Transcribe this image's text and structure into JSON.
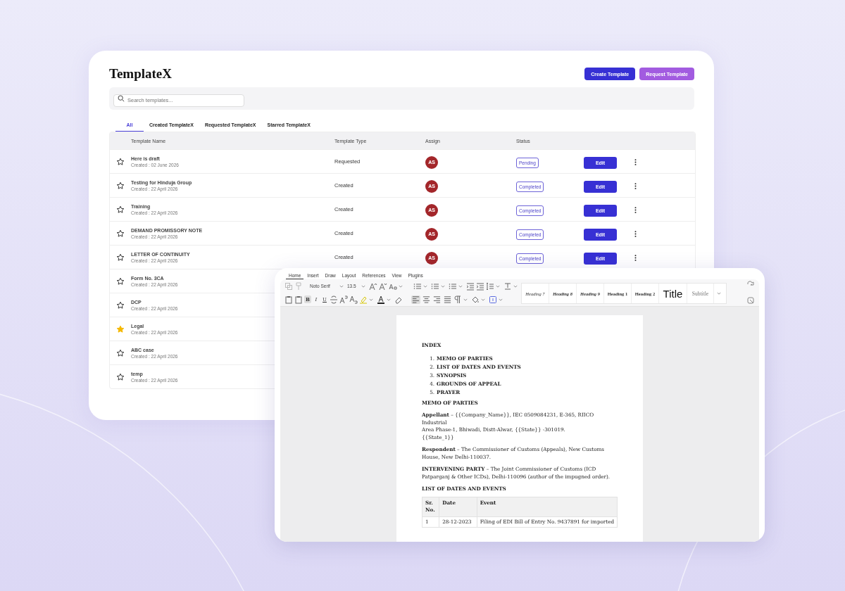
{
  "app": {
    "title": "TemplateX",
    "buttons": [
      {
        "label": "Create Template",
        "kind": "primary"
      },
      {
        "label": "Request Template",
        "kind": "secondary"
      }
    ],
    "search": {
      "placeholder": "Search templates..."
    },
    "tabs": [
      {
        "label": "All",
        "selected": true
      },
      {
        "label": "Created TemplateX",
        "selected": false
      },
      {
        "label": "Requested TemplateX",
        "selected": false
      },
      {
        "label": "Starred TemplateX",
        "selected": false
      }
    ],
    "table": {
      "columns": [
        "Template Name",
        "Template Type",
        "Assign",
        "Status"
      ],
      "rows": [
        {
          "starred": false,
          "name": "Here is draft",
          "created": "Created : 02 June 2026",
          "type": "Requested",
          "assignee": "AS",
          "status": "Pending",
          "action": "Edit"
        },
        {
          "starred": false,
          "name": "Testing for Hinduja Group",
          "created": "Created : 22 April 2026",
          "type": "Created",
          "assignee": "AS",
          "status": "Completed",
          "action": "Edit"
        },
        {
          "starred": false,
          "name": "Training",
          "created": "Created : 22 April 2026",
          "type": "Created",
          "assignee": "AS",
          "status": "Completed",
          "action": "Edit"
        },
        {
          "starred": false,
          "name": "DEMAND PROMISSORY NOTE",
          "created": "Created : 22 April 2026",
          "type": "Created",
          "assignee": "AS",
          "status": "Completed",
          "action": "Edit"
        },
        {
          "starred": false,
          "name": "LETTER OF CONTINUITY",
          "created": "Created : 22 April 2026",
          "type": "Created",
          "assignee": "AS",
          "status": "Completed",
          "action": "Edit"
        },
        {
          "starred": false,
          "name": "Form No. 3CA",
          "created": "Created : 22 April 2026"
        },
        {
          "starred": false,
          "name": "DCP",
          "created": "Created : 22 April 2026"
        },
        {
          "starred": true,
          "name": "Legal",
          "created": "Created : 22 April 2026"
        },
        {
          "starred": false,
          "name": "ABC case",
          "created": "Created : 22 April 2026"
        },
        {
          "starred": false,
          "name": "temp",
          "created": "Created : 22 April 2026"
        }
      ]
    }
  },
  "editor": {
    "menu": [
      {
        "label": "Home",
        "selected": true
      },
      {
        "label": "Insert",
        "selected": false
      },
      {
        "label": "Draw",
        "selected": false
      },
      {
        "label": "Layout",
        "selected": false
      },
      {
        "label": "References",
        "selected": false
      },
      {
        "label": "View",
        "selected": false
      },
      {
        "label": "Plugins",
        "selected": false
      }
    ],
    "font": "Noto Serif",
    "size": "13.5",
    "format_buttons": [
      {
        "label": "B",
        "kind": "bold",
        "on": true
      },
      {
        "label": "I",
        "kind": "italic",
        "on": false
      },
      {
        "label": "U",
        "kind": "underline",
        "on": false
      }
    ],
    "align_buttons": [
      {
        "kind": "left",
        "on": true
      },
      {
        "kind": "center",
        "on": false
      },
      {
        "kind": "right",
        "on": false
      },
      {
        "kind": "justify",
        "on": false
      }
    ],
    "styles": [
      {
        "label": "Heading 7",
        "kind": "italic"
      },
      {
        "label": "Heading 8",
        "kind": "italic-bold"
      },
      {
        "label": "Heading 9",
        "kind": "italic-bold"
      },
      {
        "label": "Heading 1",
        "kind": "bold"
      },
      {
        "label": "Heading 2",
        "kind": "bold"
      },
      {
        "label": "Title",
        "kind": "title"
      },
      {
        "label": "Subtitle",
        "kind": "subtitle"
      }
    ],
    "document": {
      "heading": "INDEX",
      "index": [
        {
          "number": "1.",
          "text": "MEMO OF PARTIES"
        },
        {
          "number": "2.",
          "text": "LIST OF DATES AND EVENTS"
        },
        {
          "number": "3.",
          "text": "SYNOPSIS"
        },
        {
          "number": "4.",
          "text": "GROUNDS OF APPEAL"
        },
        {
          "number": "5.",
          "text": "PRAYER"
        }
      ],
      "blocks": [
        {
          "kind": "heading",
          "lines": [
            "MEMO OF PARTIES"
          ]
        },
        {
          "kind": "paragraph",
          "lines": [
            "**Appellant** – {{Company_Name}}, IEC 0509084231, E-365, RIICO Industrial",
            "Area Phase-1, Bhiwadi, Distt-Alwar, {{State}} -301019.",
            "{{State_1}}"
          ]
        },
        {
          "kind": "paragraph",
          "lines": [
            "**Respondent** – The Commissioner of Customs (Appeals), New Customs House, New Delhi-110037."
          ]
        },
        {
          "kind": "paragraph",
          "lines": [
            "**INTERVENING PARTY** – The Joint Commissioner of Customs (ICD Patparganj & Other ICDs), Delhi-110096 (author of the impugned order)."
          ]
        },
        {
          "kind": "heading",
          "lines": [
            "LIST OF DATES AND EVENTS"
          ]
        }
      ],
      "table": {
        "columns": [
          "Sr. No.",
          "Date",
          "Event"
        ],
        "rows": [
          [
            "1",
            "28-12-2023",
            "Filing of EDI Bill of Entry No. 9437891 for imported"
          ]
        ]
      }
    }
  }
}
